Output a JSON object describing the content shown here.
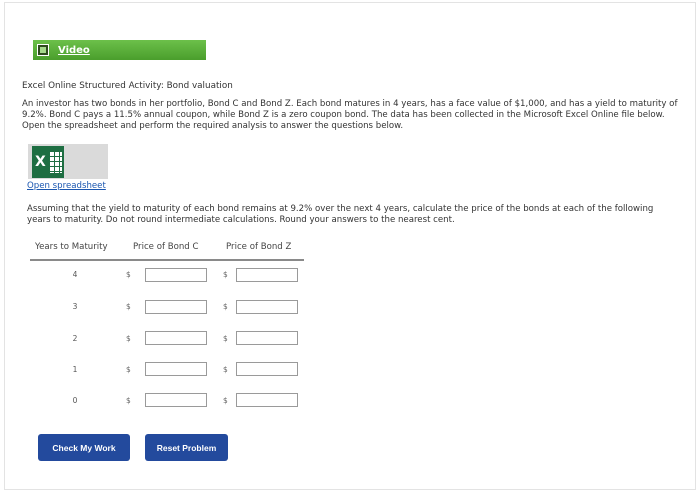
{
  "video": {
    "label": "Video"
  },
  "activity": {
    "title": "Excel Online Structured Activity: Bond valuation",
    "intro": "An investor has two bonds in her portfolio, Bond C and Bond Z. Each bond matures in 4 years, has a face value of $1,000, and has a yield to maturity of 9.2%. Bond C pays a 11.5% annual coupon, while Bond Z is a zero coupon bond. The data has been collected in the Microsoft Excel Online file below. Open the spreadsheet and perform the required analysis to answer the questions below.",
    "open_link": "Open spreadsheet",
    "question": "Assuming that the yield to maturity of each bond remains at 9.2% over the next 4 years, calculate the price of the bonds at each of the following years to maturity. Do not round intermediate calculations. Round your answers to the nearest cent."
  },
  "table": {
    "headers": [
      "Years to Maturity",
      "Price of Bond C",
      "Price of Bond Z"
    ],
    "currency_symbol": "$",
    "rows": [
      {
        "years": "4",
        "bond_c": "",
        "bond_z": ""
      },
      {
        "years": "3",
        "bond_c": "",
        "bond_z": ""
      },
      {
        "years": "2",
        "bond_c": "",
        "bond_z": ""
      },
      {
        "years": "1",
        "bond_c": "",
        "bond_z": ""
      },
      {
        "years": "0",
        "bond_c": "",
        "bond_z": ""
      }
    ]
  },
  "buttons": {
    "check": "Check My Work",
    "reset": "Reset Problem"
  },
  "colors": {
    "video_bar": "#5bb13a",
    "button": "#234a9d",
    "link": "#1a56b0",
    "excel": "#1e6e42"
  },
  "icons": {
    "video": "film-icon",
    "spreadsheet": "excel-icon"
  }
}
